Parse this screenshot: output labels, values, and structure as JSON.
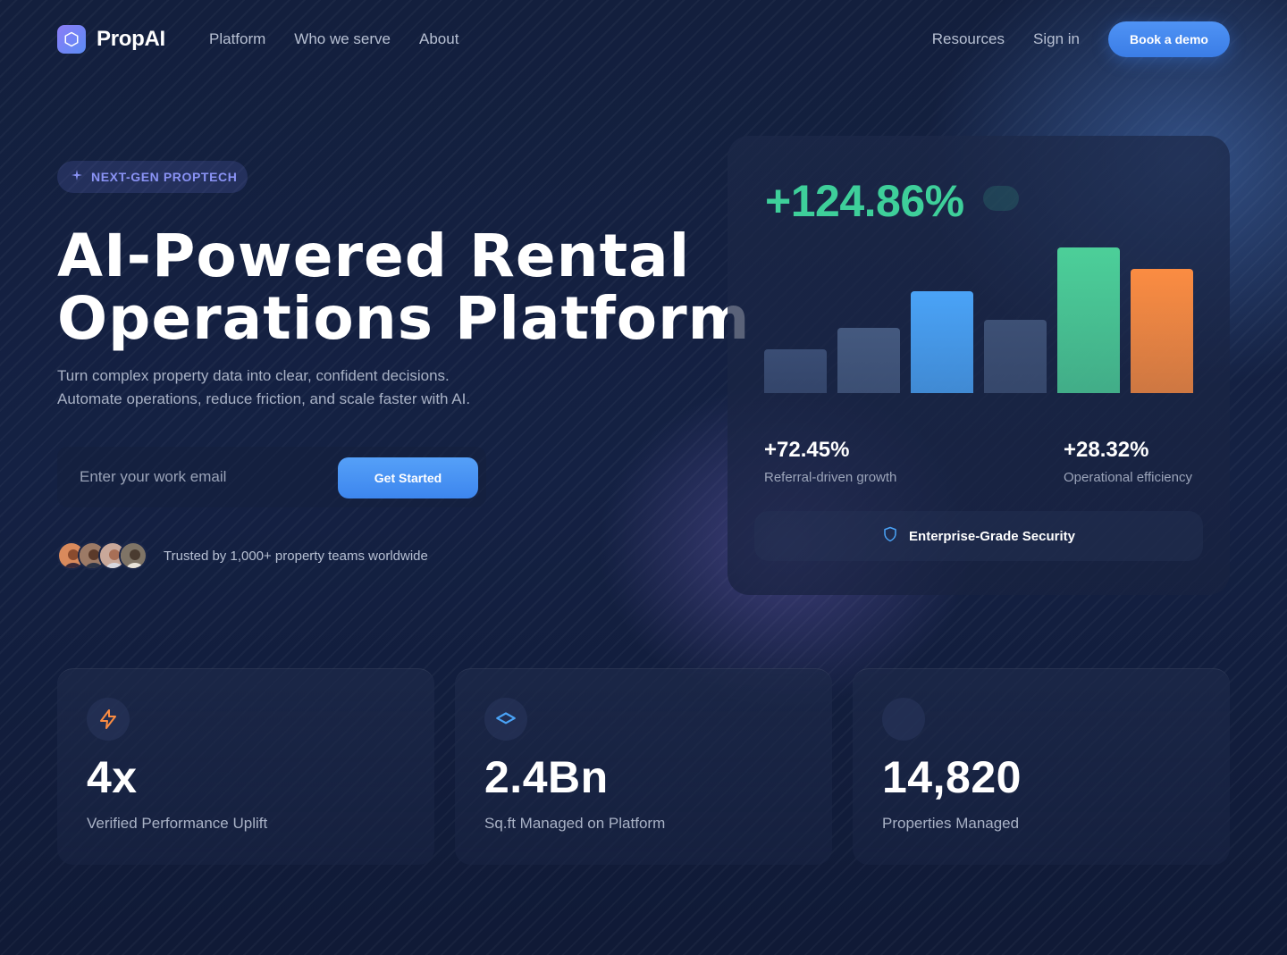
{
  "header": {
    "brand": "PropAI",
    "nav_left": [
      "Platform",
      "Who we serve",
      "About"
    ],
    "resources_label": "Resources",
    "signin_label": "Sign in",
    "demo_label": "Book a demo"
  },
  "hero": {
    "badge": "NEXT-GEN PROPTECH",
    "title_line1": "AI-Powered Rental",
    "title_line2": "Operations Platform",
    "subtitle_line1": "Turn complex property data into clear, confident decisions.",
    "subtitle_line2": "Automate operations, reduce friction, and scale faster with AI.",
    "email_placeholder": "Enter your work email",
    "cta_label": "Get Started",
    "trusted_text": "Trusted by 1,000+ property teams worldwide",
    "avatar_count": 4
  },
  "stats_card": {
    "headline": "+124.86%",
    "metrics": [
      {
        "value": "+72.45%",
        "label": "Referral-driven growth"
      },
      {
        "value": "+28.32%",
        "label": "Operational efficiency"
      }
    ],
    "security_label": "Enterprise-Grade Security"
  },
  "chart_data": {
    "type": "bar",
    "values": [
      30,
      45,
      70,
      50,
      100,
      85
    ],
    "colors": [
      "#3a4d74",
      "#44597f",
      "#4aa3f7",
      "#3d5075",
      "#4ccf99",
      "#fb8c42"
    ]
  },
  "features": [
    {
      "value": "4x",
      "label": "Verified Performance Uplift",
      "icon": "lightning-icon"
    },
    {
      "value": "2.4Bn",
      "label": "Sq.ft Managed on Platform",
      "icon": "layers-icon"
    },
    {
      "value": "14,820",
      "label": "Properties Managed",
      "icon": "building-icon"
    }
  ],
  "colors": {
    "accent_blue": "#3b82f6",
    "accent_green": "#3ecf9a",
    "accent_orange": "#fb8c42",
    "badge_purple": "#8a93f5",
    "background": "#131f3d"
  }
}
